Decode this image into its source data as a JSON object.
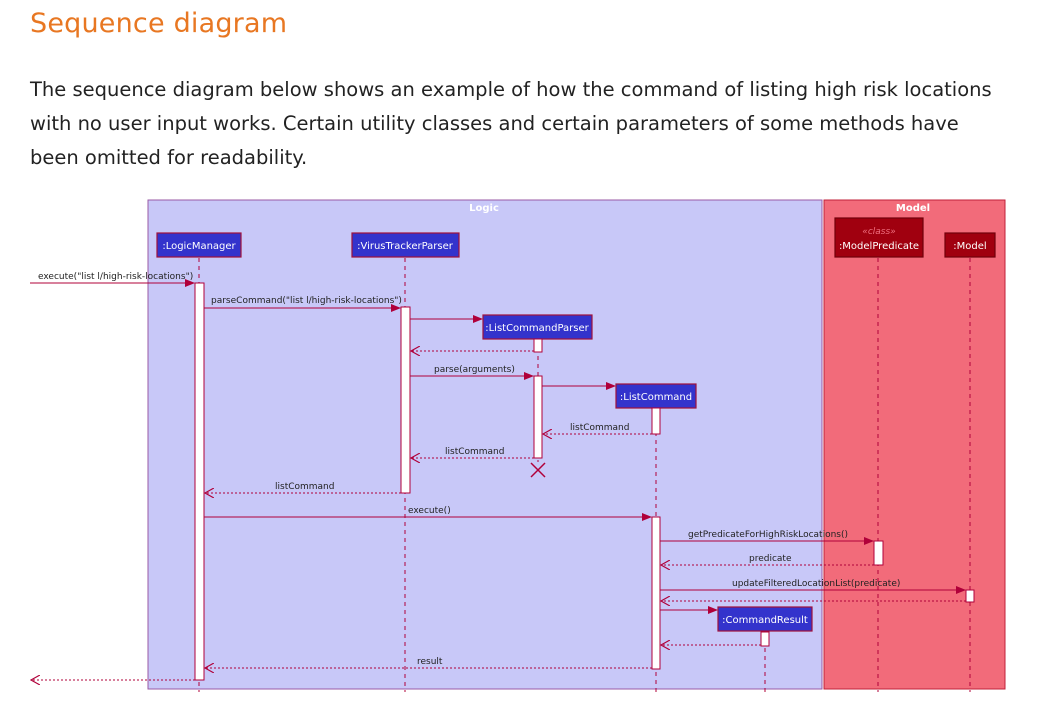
{
  "heading": "Sequence diagram",
  "intro": "The sequence diagram below shows an example of how the command of listing high risk locations with no user input works. Certain utility classes and certain parameters of some methods have been omitted for readability.",
  "colors": {
    "heading": "#e87722",
    "logic_frame": "#c8c8f8",
    "model_frame": "#f26b7a",
    "logic_participant": "#3333cc",
    "model_participant": "#a0000f",
    "arrow": "#b0003a"
  },
  "diagram": {
    "frames": {
      "logic": "Logic",
      "model": "Model"
    },
    "participants": {
      "logic_manager": ":LogicManager",
      "virus_tracker_parser": ":VirusTrackerParser",
      "list_command_parser": ":ListCommandParser",
      "list_command": ":ListCommand",
      "model_predicate_stereotype": "«class»",
      "model_predicate": ":ModelPredicate",
      "model": ":Model",
      "command_result": ":CommandResult"
    },
    "messages": {
      "execute_list": "execute(\"list l/high-risk-locations\")",
      "parse_command": "parseCommand(\"list l/high-risk-locations\")",
      "parse_arguments": "parse(arguments)",
      "list_command_return_1": "listCommand",
      "list_command_return_2": "listCommand",
      "list_command_return_3": "listCommand",
      "execute": "execute()",
      "get_predicate": "getPredicateForHighRiskLocations()",
      "predicate": "predicate",
      "update_filtered": "updateFilteredLocationList(predicate)",
      "result": "result"
    }
  }
}
